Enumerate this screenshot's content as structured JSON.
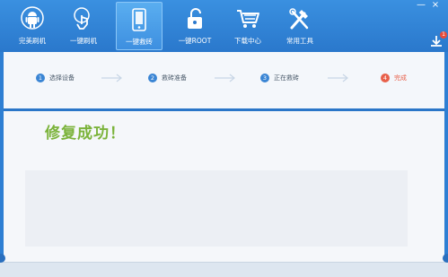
{
  "window": {
    "minimize_label": "—",
    "close_label": "×"
  },
  "toolbar": {
    "items": [
      {
        "label": "完美刷机",
        "icon": "android-robot-icon"
      },
      {
        "label": "一键刷机",
        "icon": "hand-tap-icon"
      },
      {
        "label": "一键救砖",
        "icon": "phone-repair-icon"
      },
      {
        "label": "一键ROOT",
        "icon": "lock-icon"
      },
      {
        "label": "下载中心",
        "icon": "shopping-cart-icon"
      },
      {
        "label": "常用工具",
        "icon": "tools-icon"
      }
    ],
    "active_index": 2,
    "download_badge": "1"
  },
  "steps": [
    {
      "number": "1",
      "label": "选择设备"
    },
    {
      "number": "2",
      "label": "救砖准备"
    },
    {
      "number": "3",
      "label": "正在救砖"
    },
    {
      "number": "4",
      "label": "完成"
    }
  ],
  "main": {
    "message": "修复成功！"
  },
  "colors": {
    "toolbar": "#2a78cc",
    "step_active": "#3a85d4",
    "step_done": "#e8604a",
    "success": "#7bb33a"
  }
}
